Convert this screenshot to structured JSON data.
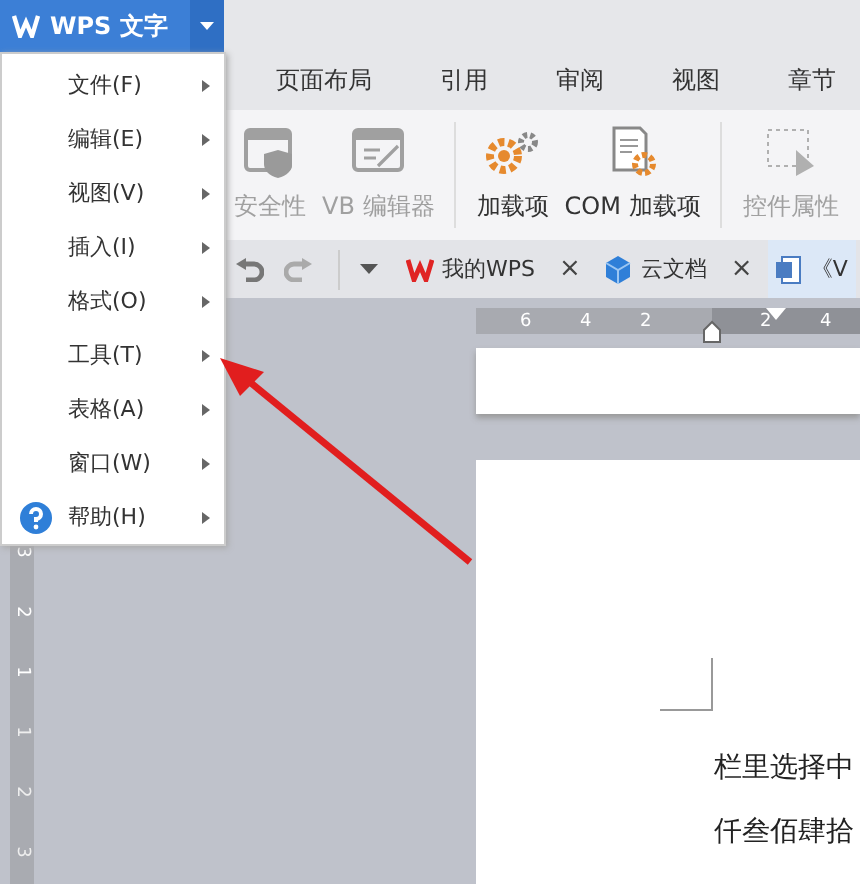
{
  "app_button": {
    "label": "WPS 文字"
  },
  "app_menu": [
    {
      "label": "文件(F)",
      "kind": "item"
    },
    {
      "label": "编辑(E)",
      "kind": "item"
    },
    {
      "label": "视图(V)",
      "kind": "item"
    },
    {
      "label": "插入(I)",
      "kind": "item"
    },
    {
      "label": "格式(O)",
      "kind": "item"
    },
    {
      "label": "工具(T)",
      "kind": "item"
    },
    {
      "label": "表格(A)",
      "kind": "item"
    },
    {
      "label": "窗口(W)",
      "kind": "item"
    },
    {
      "label": "帮助(H)",
      "kind": "help"
    }
  ],
  "ribbon_tabs": [
    "页面布局",
    "引用",
    "审阅",
    "视图",
    "章节"
  ],
  "ribbon": [
    {
      "label": "安全性",
      "kind": "shield",
      "disabled": true
    },
    {
      "label": "VB 编辑器",
      "kind": "editor",
      "disabled": true
    },
    {
      "kind": "divider"
    },
    {
      "label": "加载项",
      "kind": "gears",
      "disabled": false
    },
    {
      "label": "COM 加载项",
      "kind": "docgear",
      "disabled": false
    },
    {
      "kind": "divider"
    },
    {
      "label": "控件属性",
      "kind": "control",
      "disabled": true
    }
  ],
  "doc_tabs": [
    {
      "label": "我的WPS",
      "kind": "wps",
      "selected": false,
      "close": "×"
    },
    {
      "label": "云文档",
      "kind": "cloud",
      "selected": false,
      "close": "×"
    },
    {
      "label": "《V",
      "kind": "doc",
      "selected": true
    }
  ],
  "ruler": [
    "6",
    "4",
    "2",
    "2",
    "4"
  ],
  "vertical_ruler": [
    "3",
    "2",
    "1",
    "1",
    "2",
    "3"
  ],
  "document_lines": [
    "栏里选择中",
    "仟叁佰肆拾"
  ]
}
